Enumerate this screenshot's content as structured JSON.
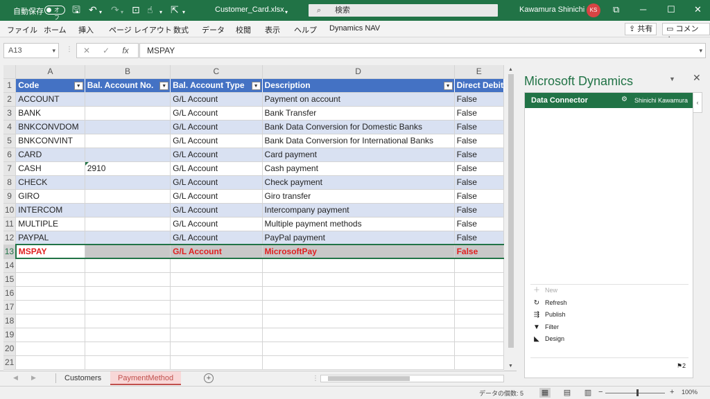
{
  "titlebar": {
    "autosave_label": "自動保存",
    "autosave_state": "オフ",
    "filename": "Customer_Card.xlsx",
    "search_placeholder": "検索",
    "user_name": "Kawamura Shinichi",
    "user_initials": "KS",
    "accent": "#217346"
  },
  "ribbon": {
    "tabs": [
      "ファイル",
      "ホーム",
      "挿入",
      "ページ レイアウト",
      "数式",
      "データ",
      "校閲",
      "表示",
      "ヘルプ",
      "Dynamics NAV"
    ],
    "share_label": "共有",
    "comment_label": "コメント"
  },
  "formula_bar": {
    "name_box": "A13",
    "value": "MSPAY"
  },
  "sheet": {
    "columns": [
      "A",
      "B",
      "C",
      "D",
      "E"
    ],
    "headers": [
      "Code",
      "Bal. Account No.",
      "Bal. Account Type",
      "Description",
      "Direct Debit"
    ],
    "rows": [
      [
        "ACCOUNT",
        "",
        "G/L Account",
        "Payment on account",
        "False"
      ],
      [
        "BANK",
        "",
        "G/L Account",
        "Bank Transfer",
        "False"
      ],
      [
        "BNKCONVDOM",
        "",
        "G/L Account",
        "Bank Data Conversion for Domestic Banks",
        "False"
      ],
      [
        "BNKCONVINT",
        "",
        "G/L Account",
        "Bank Data Conversion for International Banks",
        "False"
      ],
      [
        "CARD",
        "",
        "G/L Account",
        "Card payment",
        "False"
      ],
      [
        "CASH",
        "2910",
        "G/L Account",
        "Cash payment",
        "False"
      ],
      [
        "CHECK",
        "",
        "G/L Account",
        "Check payment",
        "False"
      ],
      [
        "GIRO",
        "",
        "G/L Account",
        "Giro transfer",
        "False"
      ],
      [
        "INTERCOM",
        "",
        "G/L Account",
        "Intercompany payment",
        "False"
      ],
      [
        "MULTIPLE",
        "",
        "G/L Account",
        "Multiple payment methods",
        "False"
      ],
      [
        "PAYPAL",
        "",
        "G/L Account",
        "PayPal payment",
        "False"
      ],
      [
        "MSPAY",
        "",
        "G/L Account",
        "MicrosoftPay",
        "False"
      ]
    ],
    "row_numbers": [
      "1",
      "2",
      "3",
      "4",
      "5",
      "6",
      "7",
      "8",
      "9",
      "10",
      "11",
      "12",
      "13",
      "14",
      "15",
      "16",
      "17",
      "18",
      "19",
      "20",
      "21"
    ],
    "header_color": "#4472c4",
    "band_color": "#d9e1f2",
    "highlight_text_color": "#e02020"
  },
  "sheet_tabs": {
    "tabs": [
      "Customers",
      "PaymentMethod"
    ],
    "active": "PaymentMethod"
  },
  "pane": {
    "title": "Microsoft Dynamics",
    "connector_title": "Data Connector",
    "connector_user": "Shinichi Kawamura",
    "actions": [
      {
        "label": "New",
        "icon": "plus-icon",
        "enabled": false
      },
      {
        "label": "Refresh",
        "icon": "refresh-icon",
        "enabled": true
      },
      {
        "label": "Publish",
        "icon": "publish-icon",
        "enabled": true
      },
      {
        "label": "Filter",
        "icon": "filter-icon",
        "enabled": true
      },
      {
        "label": "Design",
        "icon": "design-icon",
        "enabled": true
      }
    ],
    "notification_count": "2"
  },
  "statusbar": {
    "count_text": "データの個数: 5",
    "zoom": "100%"
  }
}
